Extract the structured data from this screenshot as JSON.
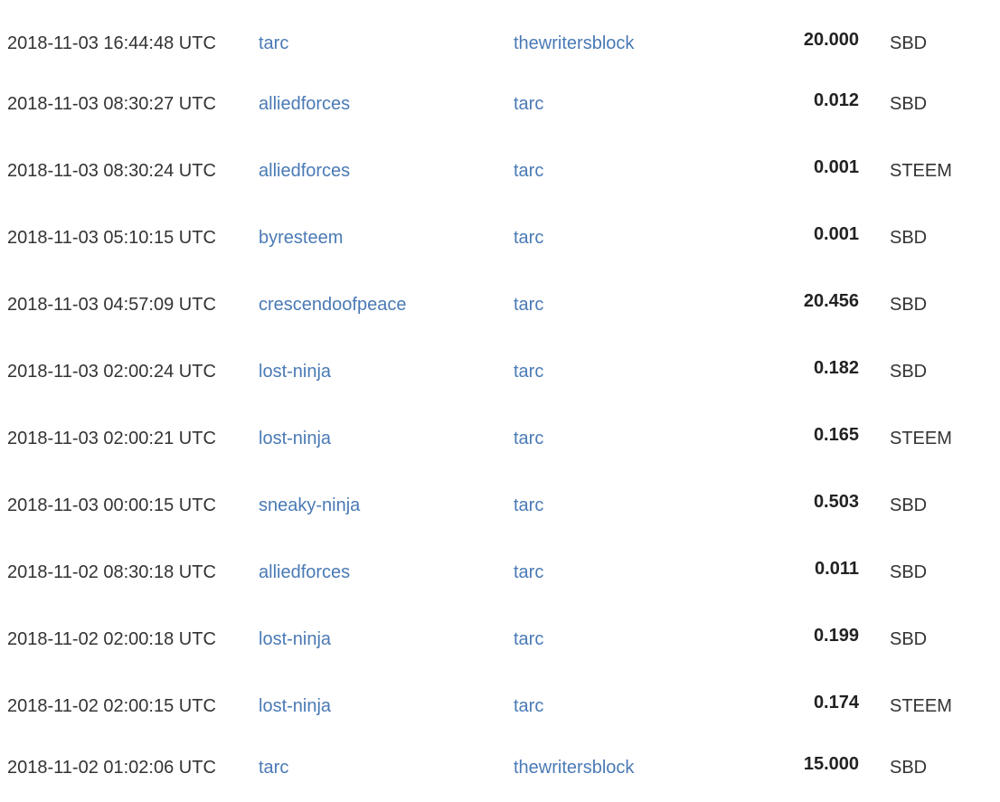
{
  "transfers": [
    {
      "date": "2018-11-03 16:44:48 UTC",
      "from": "tarc",
      "to": "thewritersblock",
      "amount": "20.000",
      "currency": "SBD"
    },
    {
      "date": "2018-11-03 08:30:27 UTC",
      "from": "alliedforces",
      "to": "tarc",
      "amount": "0.012",
      "currency": "SBD"
    },
    {
      "date": "2018-11-03 08:30:24 UTC",
      "from": "alliedforces",
      "to": "tarc",
      "amount": "0.001",
      "currency": "STEEM"
    },
    {
      "date": "2018-11-03 05:10:15 UTC",
      "from": "byresteem",
      "to": "tarc",
      "amount": "0.001",
      "currency": "SBD"
    },
    {
      "date": "2018-11-03 04:57:09 UTC",
      "from": "crescendoofpeace",
      "to": "tarc",
      "amount": "20.456",
      "currency": "SBD"
    },
    {
      "date": "2018-11-03 02:00:24 UTC",
      "from": "lost-ninja",
      "to": "tarc",
      "amount": "0.182",
      "currency": "SBD"
    },
    {
      "date": "2018-11-03 02:00:21 UTC",
      "from": "lost-ninja",
      "to": "tarc",
      "amount": "0.165",
      "currency": "STEEM"
    },
    {
      "date": "2018-11-03 00:00:15 UTC",
      "from": "sneaky-ninja",
      "to": "tarc",
      "amount": "0.503",
      "currency": "SBD"
    },
    {
      "date": "2018-11-02 08:30:18 UTC",
      "from": "alliedforces",
      "to": "tarc",
      "amount": "0.011",
      "currency": "SBD"
    },
    {
      "date": "2018-11-02 02:00:18 UTC",
      "from": "lost-ninja",
      "to": "tarc",
      "amount": "0.199",
      "currency": "SBD"
    },
    {
      "date": "2018-11-02 02:00:15 UTC",
      "from": "lost-ninja",
      "to": "tarc",
      "amount": "0.174",
      "currency": "STEEM"
    },
    {
      "date": "2018-11-02 01:02:06 UTC",
      "from": "tarc",
      "to": "thewritersblock",
      "amount": "15.000",
      "currency": "SBD"
    }
  ],
  "colors": {
    "link": "#4a7ab5",
    "text": "#333333",
    "amount": "#222222"
  }
}
